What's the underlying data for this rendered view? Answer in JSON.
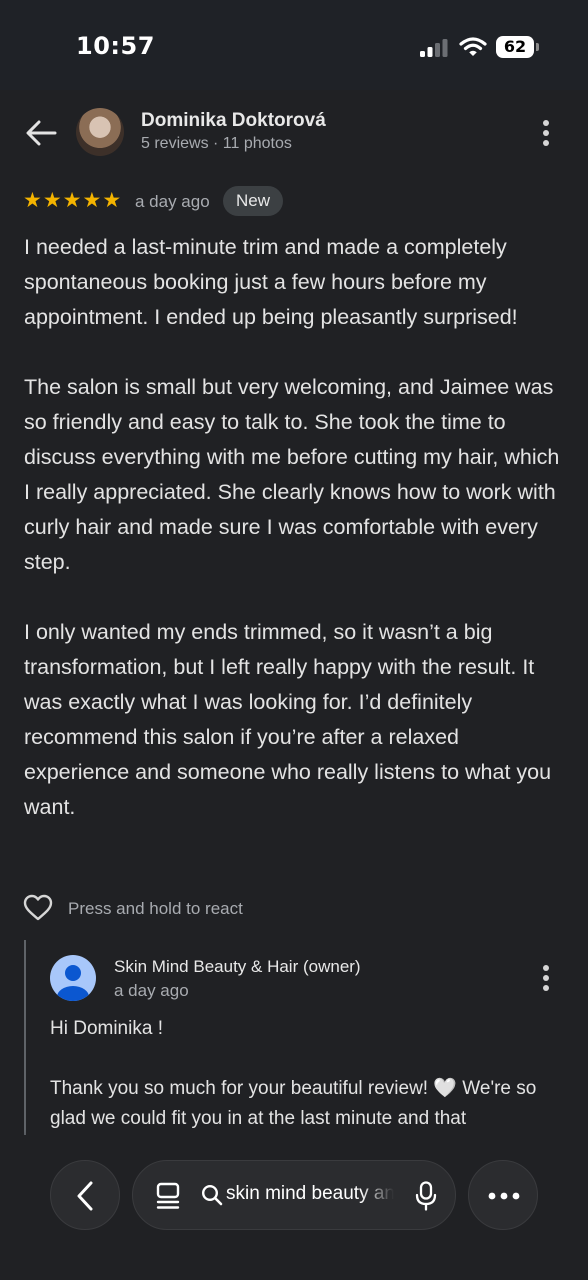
{
  "status_bar": {
    "time": "10:57",
    "battery": "62"
  },
  "reviewer": {
    "name": "Dominika Doktorová",
    "meta": "5 reviews · 11 photos"
  },
  "review": {
    "rating": 5,
    "time_ago": "a day ago",
    "badge": "New",
    "paragraphs": [
      "I needed a last-minute trim and made a completely spontaneous booking just a few hours before my appointment. I ended up being pleasantly surprised!",
      "The salon is small but very welcoming, and Jaimee was so friendly and easy to talk to. She took the time to discuss everything with me before cutting my hair, which I really appreciated. She clearly knows how to work with curly hair and made sure I was comfortable with every step.",
      "I only wanted my ends trimmed, so it wasn’t a big transformation, but I left really happy with the result. It was exactly what I was looking for. I’d definitely recommend this salon if you’re after a relaxed experience and someone who really listens to what you want."
    ],
    "react_hint": "Press and hold to react"
  },
  "owner_reply": {
    "name": "Skin Mind Beauty & Hair (owner)",
    "time_ago": "a day ago",
    "greeting": "Hi Dominika !",
    "body": "Thank you so much for your beautiful review! 🤍 We're so glad we could fit you in at the last minute and that"
  },
  "bottom_bar": {
    "search_query": "skin mind beauty and hair"
  },
  "icons": {
    "back": "arrow-left-icon",
    "more": "more-vert-icon",
    "star": "star-icon",
    "heart": "heart-outline-icon",
    "owner_avatar": "person-icon",
    "nav_back": "chevron-left-icon",
    "tabs": "tabs-icon",
    "search": "search-icon",
    "mic": "mic-icon",
    "nav_more": "more-horiz-icon"
  },
  "colors": {
    "background": "#202124",
    "star": "#f4b400",
    "badge_bg": "#3c4043",
    "secondary_text": "#a8abb0",
    "owner_avatar": "#a8c7fa"
  }
}
